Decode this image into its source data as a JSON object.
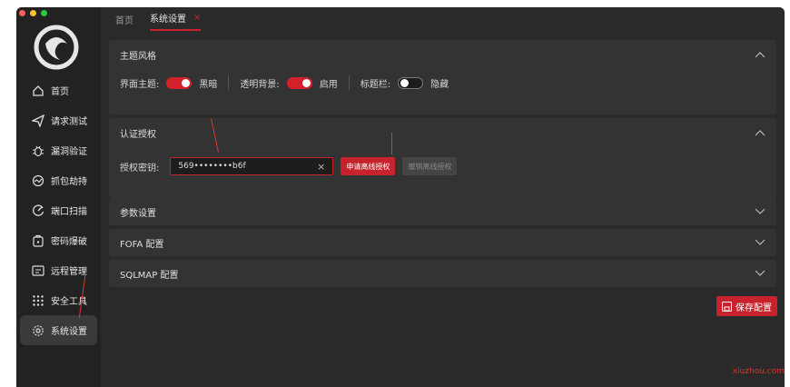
{
  "tabs": [
    {
      "label": "首页"
    },
    {
      "label": "系统设置",
      "close": "×"
    }
  ],
  "sidebar": {
    "items": [
      {
        "label": "首页",
        "icon": "home-icon"
      },
      {
        "label": "请求测试",
        "icon": "send-icon"
      },
      {
        "label": "漏洞验证",
        "icon": "bug-icon"
      },
      {
        "label": "抓包劫持",
        "icon": "capture-icon"
      },
      {
        "label": "端口扫描",
        "icon": "gauge-icon"
      },
      {
        "label": "密码爆破",
        "icon": "lock-icon"
      },
      {
        "label": "远程管理",
        "icon": "terminal-icon"
      },
      {
        "label": "安全工具",
        "icon": "grid-icon"
      },
      {
        "label": "系统设置",
        "icon": "gear-icon"
      }
    ]
  },
  "theme": {
    "title": "主题风格",
    "interface_label": "界面主题:",
    "interface_value": "黑暗",
    "transparent_label": "透明背景:",
    "transparent_value": "启用",
    "titlebar_label": "标题栏:",
    "titlebar_value": "隐藏"
  },
  "auth": {
    "title": "认证授权",
    "key_label": "授权密钥:",
    "key_value": "569••••••••b6f",
    "clear": "×",
    "apply_label": "申请离线授权",
    "revoke_label": "撤销离线授权"
  },
  "params": {
    "title": "参数设置"
  },
  "fofa": {
    "title": "FOFA 配置"
  },
  "sqlmap": {
    "title": "SQLMAP 配置"
  },
  "save_label": "保存配置",
  "watermark": "xiuzhou.com",
  "colors": {
    "accent": "#c8232c"
  }
}
